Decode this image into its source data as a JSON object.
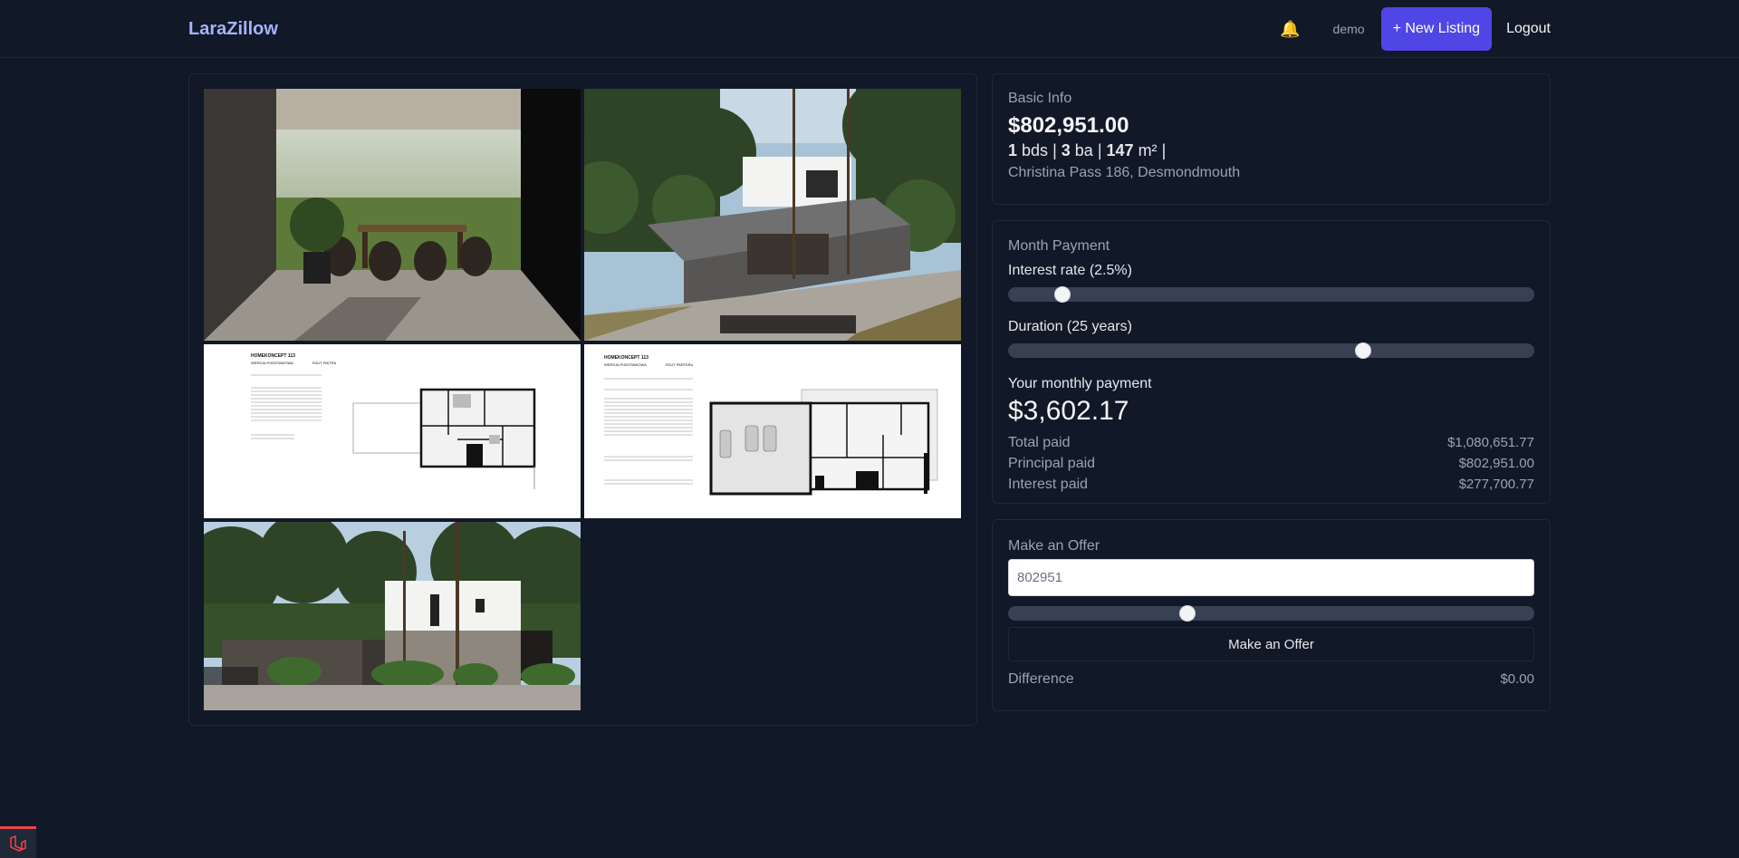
{
  "header": {
    "brand": "LaraZillow",
    "bell_icon": "bell-icon",
    "user": "demo",
    "new_listing_label": "+ New Listing",
    "logout_label": "Logout"
  },
  "gallery": {
    "images": [
      {
        "alt": "covered patio with dining table"
      },
      {
        "alt": "modern house exterior among pine trees"
      },
      {
        "alt": "floor plan upper floor"
      },
      {
        "alt": "floor plan ground floor"
      },
      {
        "alt": "house front view"
      }
    ],
    "plan_a": {
      "title": "HOMEKONCEPT 113",
      "sub": "WERSJA PODSTAWOWA",
      "floor": "RZUT PIĘTRA"
    },
    "plan_b": {
      "title": "HOMEKONCEPT 113",
      "sub": "WERSJA PODSTAWOWA",
      "floor": "RZUT PARTERU"
    }
  },
  "basic_info": {
    "title": "Basic Info",
    "price": "$802,951.00",
    "beds": "1",
    "beds_unit": "bds",
    "baths": "3",
    "baths_unit": "ba",
    "area": "147",
    "area_unit": "m²",
    "address": "Christina Pass 186, Desmondmouth"
  },
  "month_payment": {
    "title": "Month Payment",
    "interest_label": "Interest rate (2.5%)",
    "interest_fraction": 0.09,
    "duration_label": "Duration (25 years)",
    "duration_fraction": 0.68,
    "monthly_label": "Your monthly payment",
    "monthly_value": "$3,602.17",
    "rows": [
      {
        "label": "Total paid",
        "value": "$1,080,651.77"
      },
      {
        "label": "Principal paid",
        "value": "$802,951.00"
      },
      {
        "label": "Interest paid",
        "value": "$277,700.77"
      }
    ]
  },
  "offer": {
    "title": "Make an Offer",
    "input_value": "802951",
    "slider_fraction": 0.335,
    "button_label": "Make an Offer",
    "difference_label": "Difference",
    "difference_value": "$0.00"
  },
  "colors": {
    "background": "#111827",
    "accent": "#4f46e5",
    "brand": "#a5b4fc"
  }
}
